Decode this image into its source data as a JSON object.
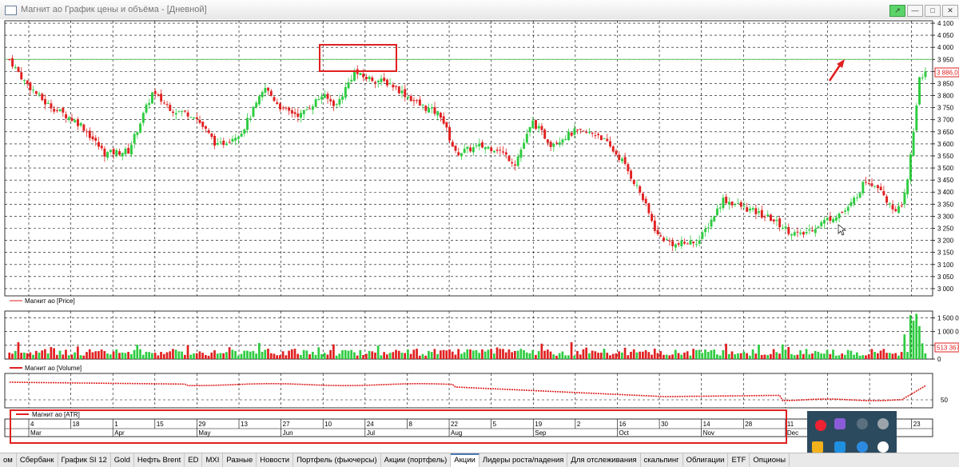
{
  "window": {
    "title": "Магнит ао График цены и объёма - [Дневной]",
    "buttons": [
      "↗",
      "—",
      "□",
      "✕"
    ]
  },
  "panels": {
    "price_label": "Магнит ао [Price]",
    "volume_label": "Магнит ао [Volume]",
    "atr_label": "Магнит ао [ATR]",
    "price_last": "3 886,0",
    "volume_last": "513 367"
  },
  "tabs": [
    {
      "label": "ом",
      "active": false
    },
    {
      "label": "Сбербанк",
      "active": false
    },
    {
      "label": "График SI 12",
      "active": false
    },
    {
      "label": "Gold",
      "active": false
    },
    {
      "label": "Нефть Brent",
      "active": false
    },
    {
      "label": "ED",
      "active": false
    },
    {
      "label": "MXI",
      "active": false
    },
    {
      "label": "Разные",
      "active": false
    },
    {
      "label": "Новости",
      "active": false
    },
    {
      "label": "Портфель (фьючерсы)",
      "active": false
    },
    {
      "label": "Акции (портфель)",
      "active": false
    },
    {
      "label": "Акции",
      "active": true
    },
    {
      "label": "Лидеры роста/падения",
      "active": false
    },
    {
      "label": "Для отслеживания",
      "active": false
    },
    {
      "label": "скальпинг",
      "active": false
    },
    {
      "label": "Облигации",
      "active": false
    },
    {
      "label": "ETF",
      "active": false
    },
    {
      "label": "Опционы",
      "active": false
    }
  ],
  "colors": {
    "up": "#2ecc40",
    "down": "#e02020",
    "grid": "#000000",
    "annotation": "#ff0000",
    "hline": "#5fc45f",
    "tray": "#2c4a5e"
  },
  "chart_data": {
    "type": "candlestick",
    "x_axis": {
      "day_ticks": [
        "4",
        "18",
        "1",
        "15",
        "29",
        "13",
        "27",
        "10",
        "24",
        "8",
        "22",
        "5",
        "19",
        "2",
        "16",
        "30",
        "14",
        "28",
        "11",
        "25",
        "9",
        "23"
      ],
      "month_ticks": [
        "Mar",
        "Apr",
        "May",
        "Jun",
        "Jul",
        "Aug",
        "Sep",
        "Oct",
        "Nov",
        "Dec"
      ]
    },
    "price": {
      "ylim": [
        2970,
        4110
      ],
      "yticks": [
        "4 100",
        "4 050",
        "4 000",
        "3 950",
        "3 900",
        "3 850",
        "3 800",
        "3 750",
        "3 700",
        "3 650",
        "3 600",
        "3 550",
        "3 500",
        "3 450",
        "3 400",
        "3 350",
        "3 300",
        "3 250",
        "3 200",
        "3 150",
        "3 100",
        "3 050",
        "3 000"
      ],
      "horizontal_line": 3950,
      "last_value": 3886,
      "anchors": [
        [
          0,
          3950
        ],
        [
          5,
          3860
        ],
        [
          12,
          3770
        ],
        [
          24,
          3680
        ],
        [
          32,
          3560
        ],
        [
          40,
          3570
        ],
        [
          48,
          3810
        ],
        [
          55,
          3740
        ],
        [
          62,
          3720
        ],
        [
          70,
          3590
        ],
        [
          78,
          3650
        ],
        [
          86,
          3830
        ],
        [
          92,
          3740
        ],
        [
          98,
          3720
        ],
        [
          105,
          3800
        ],
        [
          110,
          3760
        ],
        [
          116,
          3900
        ],
        [
          118,
          3880
        ],
        [
          128,
          3850
        ],
        [
          138,
          3760
        ],
        [
          145,
          3720
        ],
        [
          150,
          3560
        ],
        [
          158,
          3590
        ],
        [
          164,
          3580
        ],
        [
          170,
          3520
        ],
        [
          176,
          3690
        ],
        [
          182,
          3600
        ],
        [
          190,
          3650
        ],
        [
          198,
          3640
        ],
        [
          206,
          3530
        ],
        [
          212,
          3400
        ],
        [
          218,
          3220
        ],
        [
          224,
          3180
        ],
        [
          232,
          3200
        ],
        [
          240,
          3370
        ],
        [
          248,
          3330
        ],
        [
          256,
          3290
        ],
        [
          262,
          3240
        ],
        [
          266,
          3220
        ],
        [
          274,
          3280
        ],
        [
          282,
          3330
        ],
        [
          288,
          3450
        ],
        [
          293,
          3420
        ],
        [
          296,
          3340
        ],
        [
          300,
          3330
        ],
        [
          302,
          3450
        ],
        [
          304,
          3650
        ],
        [
          306,
          3880
        ],
        [
          308,
          3890
        ]
      ]
    },
    "volume": {
      "yticks": [
        "1 500 000",
        "1 000 000",
        "500 000",
        "0"
      ],
      "last_value": 513367,
      "spikes": [
        [
          301,
          900000
        ],
        [
          303,
          1600000
        ],
        [
          304,
          1400000
        ],
        [
          305,
          1650000
        ],
        [
          306,
          1200000
        ]
      ]
    },
    "atr": {
      "yticks": [
        "50"
      ]
    }
  }
}
